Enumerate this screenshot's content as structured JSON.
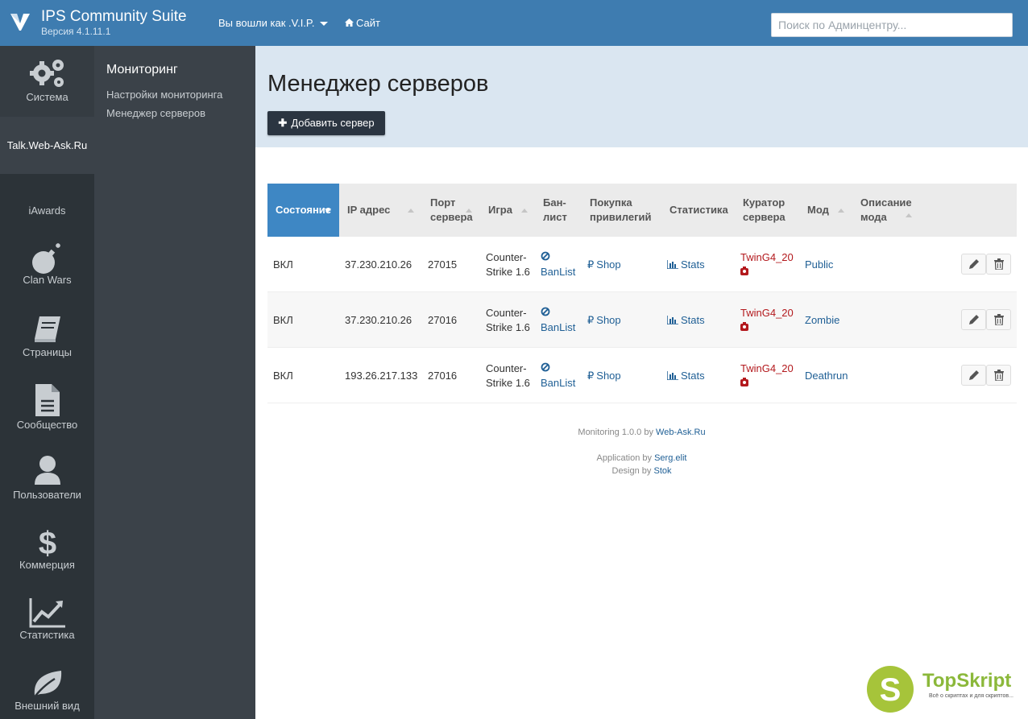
{
  "header": {
    "brand_title": "IPS Community Suite",
    "brand_version": "Версия 4.1.11.1",
    "user_menu": "Вы вошли как .V.I.P.",
    "site_link": "Сайт",
    "search_placeholder": "Поиск по Админцентру..."
  },
  "leftnav": [
    {
      "label": "Система",
      "icon": "gears-icon"
    },
    {
      "label": "Talk.Web-Ask.Ru",
      "icon": ""
    },
    {
      "label": "iAwards",
      "icon": ""
    },
    {
      "label": "Clan Wars",
      "icon": "bomb-icon"
    },
    {
      "label": "Страницы",
      "icon": "book-icon"
    },
    {
      "label": "Сообщество",
      "icon": "document-icon"
    },
    {
      "label": "Пользователи",
      "icon": "user-icon"
    },
    {
      "label": "Коммерция",
      "icon": "dollar-icon"
    },
    {
      "label": "Статистика",
      "icon": "chart-icon"
    },
    {
      "label": "Внешний вид",
      "icon": "leaf-icon"
    }
  ],
  "subnav": {
    "title": "Мониторинг",
    "links": [
      "Настройки мониторинга",
      "Менеджер серверов"
    ]
  },
  "main": {
    "title": "Менеджер серверов",
    "add_button": "Добавить сервер"
  },
  "table": {
    "headers": [
      "Состояние",
      "IP адрес",
      "Порт сервера",
      "Игра",
      "Бан-лист",
      "Покупка привилегий",
      "Статистика",
      "Куратор сервера",
      "Мод",
      "Описание мода"
    ],
    "rows": [
      {
        "status": "ВКЛ",
        "ip": "37.230.210.26",
        "port": "27015",
        "game": "Counter-Strike 1.6",
        "banlist": "BanList",
        "shop": "Shop",
        "stats": "Stats",
        "curator": "TwinG4_20",
        "mod": "Public"
      },
      {
        "status": "ВКЛ",
        "ip": "37.230.210.26",
        "port": "27016",
        "game": "Counter-Strike 1.6",
        "banlist": "BanList",
        "shop": "Shop",
        "stats": "Stats",
        "curator": "TwinG4_20",
        "mod": "Zombie"
      },
      {
        "status": "ВКЛ",
        "ip": "193.26.217.133",
        "port": "27016",
        "game": "Counter-Strike 1.6",
        "banlist": "BanList",
        "shop": "Shop",
        "stats": "Stats",
        "curator": "TwinG4_20",
        "mod": "Deathrun"
      }
    ]
  },
  "footer": {
    "monitoring_prefix": "Monitoring 1.0.0 by",
    "monitoring_link": "Web-Ask.Ru",
    "app_prefix": "Application by",
    "app_link": "Serg.elit",
    "design_prefix": "Design by",
    "design_link": "Stok"
  },
  "watermark": {
    "name": "TopSkript",
    "tagline": "Всё о скриптах и для скриптов..."
  },
  "colors": {
    "header_bg": "#3e7cb0",
    "nav_bg": "#2c3338",
    "subnav_bg": "#3b4249",
    "page_head_bg": "#dae6f1",
    "active_header": "#3e87c4",
    "link": "#1f5f95",
    "curator": "#b3191d"
  }
}
